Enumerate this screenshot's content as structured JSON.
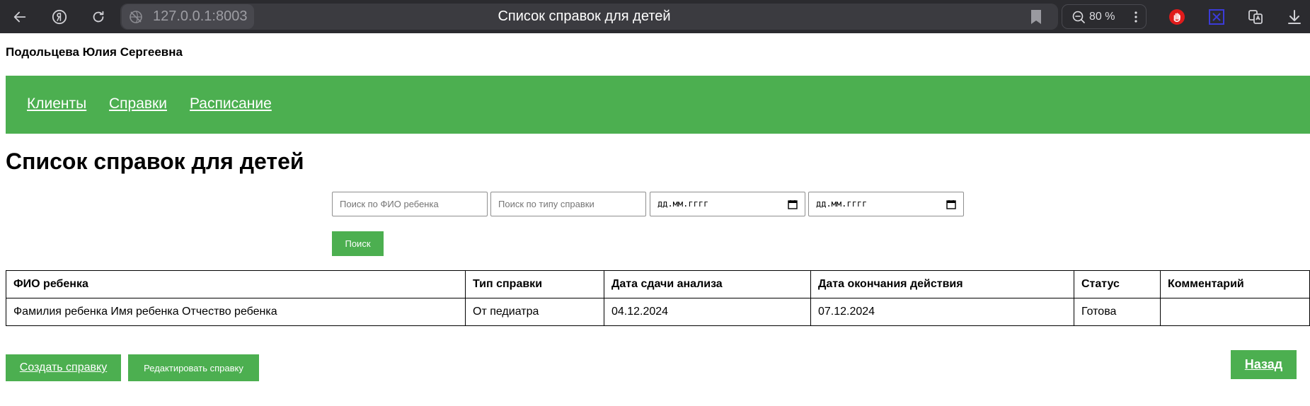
{
  "browser": {
    "url_host": "127.0.0.1:8003",
    "tab_title": "Список справок для детей",
    "zoom": "80 %",
    "icons": {
      "back": "back-arrow-icon",
      "yandex": "yandex-logo-icon",
      "reload": "reload-icon",
      "site": "site-globe-icon",
      "bookmark": "bookmark-icon",
      "zoom": "zoom-out-icon",
      "more": "more-vertical-icon",
      "ext1": "hand-stop-extension-icon",
      "ext2": "box-x-extension-icon",
      "ext3": "translate-extension-icon",
      "download": "download-icon"
    }
  },
  "header": {
    "user_name": "Подольцева Юлия Сергеевна"
  },
  "nav": {
    "items": [
      {
        "label": "Клиенты"
      },
      {
        "label": "Справки"
      },
      {
        "label": "Расписание"
      }
    ]
  },
  "page": {
    "title": "Список справок для детей"
  },
  "filters": {
    "child_name_placeholder": "Поиск по ФИО ребенка",
    "type_placeholder": "Поиск по типу справки",
    "date_from": "дд.мм.гггг",
    "date_to": "дд.мм.гггг",
    "search_label": "Поиск"
  },
  "table": {
    "columns": [
      "ФИО ребенка",
      "Тип справки",
      "Дата сдачи анализа",
      "Дата окончания действия",
      "Статус",
      "Комментарий"
    ],
    "rows": [
      [
        "Фамилия ребенка Имя ребенка Отчество ребенка",
        "От педиатра",
        "04.12.2024",
        "07.12.2024",
        "Готова",
        ""
      ]
    ]
  },
  "actions": {
    "create_label": "Создать справку",
    "edit_label": "Редактировать справку",
    "back_label": "Назад"
  },
  "colors": {
    "accent": "#4caf50",
    "chrome_bg": "#2b2b2f"
  }
}
